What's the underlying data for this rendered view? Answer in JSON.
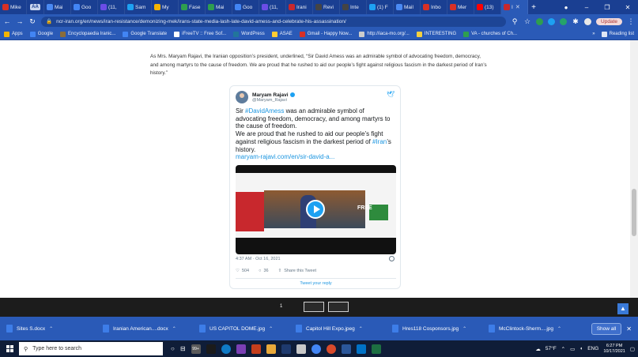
{
  "tabs": [
    {
      "label": "Mike",
      "color": "#d93025"
    },
    {
      "label": "AA",
      "color": "#c9d6ef"
    },
    {
      "label": "Mai",
      "color": "#4a8af4"
    },
    {
      "label": "Goo",
      "color": "#4285f4"
    },
    {
      "label": "(11,",
      "color": "#6b4de6"
    },
    {
      "label": "Sam",
      "color": "#1da1f2"
    },
    {
      "label": "My",
      "color": "#f4b400"
    },
    {
      "label": "Fase",
      "color": "#2e9e4f"
    },
    {
      "label": "Mai",
      "color": "#2e9e4f"
    },
    {
      "label": "Goo",
      "color": "#4285f4"
    },
    {
      "label": "(11,",
      "color": "#6b4de6"
    },
    {
      "label": "Irani",
      "color": "#c8282d"
    },
    {
      "label": "Revi",
      "color": "#444"
    },
    {
      "label": "Inte",
      "color": "#444"
    },
    {
      "label": "(1) F",
      "color": "#1da1f2"
    },
    {
      "label": "Mail",
      "color": "#4a8af4"
    },
    {
      "label": "Inbo",
      "color": "#d93025"
    },
    {
      "label": "Mer",
      "color": "#d93025"
    },
    {
      "label": "(13)",
      "color": "#ff0000"
    },
    {
      "label": "I",
      "color": "#c8282d"
    }
  ],
  "toolbar": {
    "url": "ncr-iran.org/en/news/iran-resistance/demonizing-mek/irans-state-media-lash-late-david-amess-and-celebrate-his-assassination/",
    "update_label": "Update"
  },
  "bookmarks": {
    "items": [
      "Apps",
      "Google",
      "Encyclopaedia Iranic...",
      "Google Translate",
      "iFreeTV :: Free Sof...",
      "WordPress",
      "ASAE",
      "Gmail - Happy Now...",
      "http://iaca-mo.org/...",
      "INTERESTING",
      "VA - churches of Ch..."
    ],
    "more": "»",
    "reading_list": "Reading list"
  },
  "article": {
    "paragraph": "As Mrs. Maryam Rajavi, the Iranian opposition’s president, underlined, “Sir David Amess was an admirable symbol of advocating freedom, democracy, and among martyrs to the cause of freedom. We are proud that he rushed to aid our people’s fight against religious fascism in the darkest period of Iran’s history.”"
  },
  "tweet": {
    "name": "Maryam Rajavi",
    "handle": "@Maryam_Rajavi",
    "text_1a": "Sir ",
    "hashtag_1": "#DavidAmess",
    "text_1b": " was an admirable symbol of advocating freedom, democracy, and among martyrs to the cause of freedom.",
    "text_2a": "We are proud that he rushed to aid our people’s fight against religious fascism in the darkest period of ",
    "hashtag_2": "#Iran",
    "text_2b": "’s history.",
    "link": "maryam-rajavi.com/en/sir-david-a...",
    "video_overlay": "FREE",
    "time": "4:37 AM · Oct 16, 2021",
    "likes": "504",
    "replies": "36",
    "share": "Share this Tweet",
    "reply_prompt": "Tweet your reply"
  },
  "pager": {
    "current": "1"
  },
  "downloads": {
    "files": [
      "Sites S.docx",
      "Iranian American....docx",
      "US CAPITOL DOME.jpg",
      "Capitol Hill Expo.jpeg",
      "Hres118 Cosponsors.jpg",
      "McClintock-Sherm....jpg"
    ],
    "show_all": "Show all"
  },
  "taskbar": {
    "search_placeholder": "Type here to search",
    "badge": "99+",
    "weather": "57°F",
    "lang": "ENG",
    "time": "6:27 PM",
    "date": "10/17/2021"
  }
}
